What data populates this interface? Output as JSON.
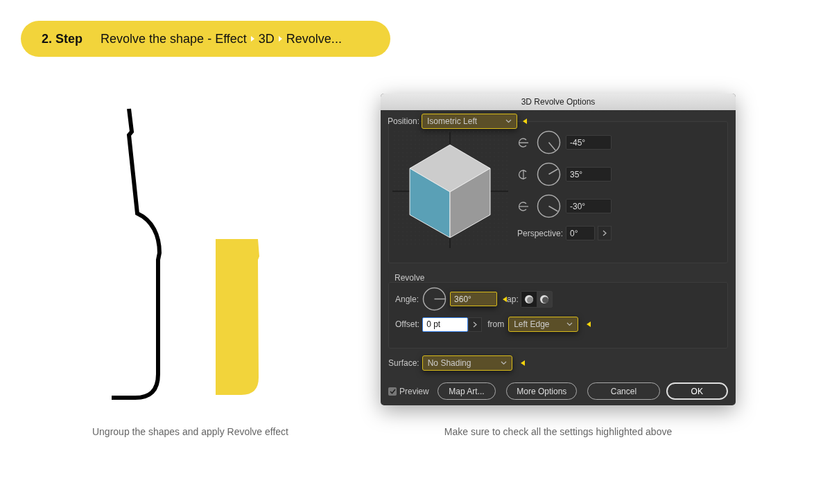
{
  "step": {
    "number": "2. Step",
    "path": [
      "Revolve the shape - Effect",
      "3D",
      "Revolve..."
    ]
  },
  "drawing_caption": "Ungroup the shapes and apply Revolve effect",
  "dialog": {
    "title": "3D Revolve Options",
    "position": {
      "label": "Position:",
      "value": "Isometric Left",
      "highlighted": true
    },
    "rotations": [
      {
        "value": "-45°"
      },
      {
        "value": "35°"
      },
      {
        "value": "-30°"
      }
    ],
    "perspective": {
      "label": "Perspective:",
      "value": "0°"
    },
    "revolve": {
      "title": "Revolve",
      "angle": {
        "label": "Angle:",
        "value": "360°",
        "highlighted": true
      },
      "cap": {
        "label": "ap:",
        "options": [
          {
            "selected": true
          },
          {
            "selected": false
          }
        ]
      },
      "offset": {
        "label": "Offset:",
        "value": "0 pt",
        "focused": true
      },
      "from": {
        "label": "from",
        "value": "Left Edge",
        "highlighted": true
      }
    },
    "surface": {
      "label": "Surface:",
      "value": "No Shading",
      "highlighted": true
    },
    "preview": {
      "label": "Preview",
      "checked": true
    },
    "buttons": [
      {
        "label": "Map Art...",
        "default": false
      },
      {
        "label": "More Options",
        "default": false
      },
      {
        "label": "Cancel",
        "default": false
      },
      {
        "label": "OK",
        "default": true
      }
    ]
  },
  "dialog_caption": "Make sure to check all the settings highlighted above"
}
